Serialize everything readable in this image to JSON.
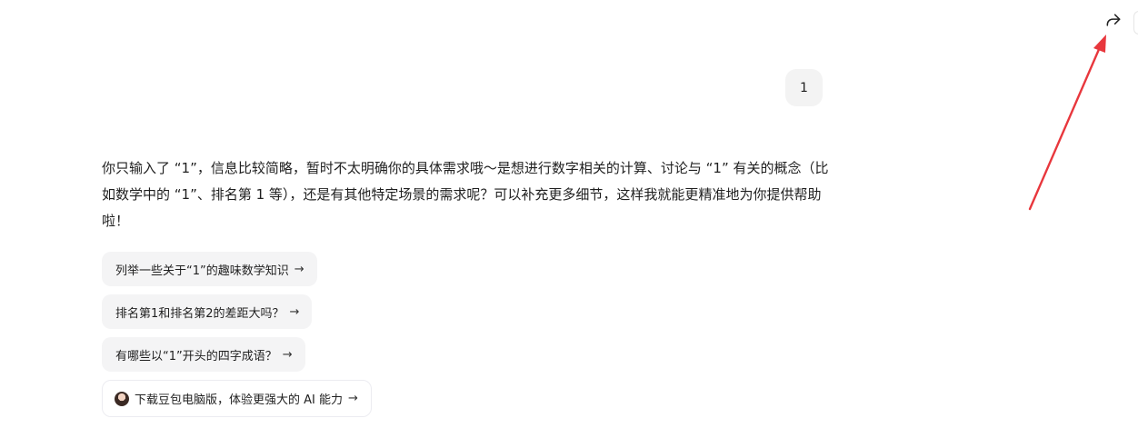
{
  "header": {
    "share_icon": "share-forward-icon"
  },
  "conversation": {
    "user_message": "1",
    "reply_text": "你只输入了 “1”，信息比较简略，暂时不太明确你的具体需求哦～是想进行数字相关的计算、讨论与 “1” 有关的概念（比如数学中的 “1”、排名第 1 等），还是有其他特定场景的需求呢？可以补充更多细节，这样我就能更精准地为你提供帮助啦！"
  },
  "suggestions": [
    {
      "label": "列举一些关于“1”的趣味数学知识",
      "arrow": "→"
    },
    {
      "label": "排名第1和排名第2的差距大吗？",
      "arrow": "→"
    },
    {
      "label": "有哪些以“1”开头的四字成语？",
      "arrow": "→"
    }
  ],
  "promo": {
    "label": "下载豆包电脑版，体验更强大的 AI 能力",
    "arrow": "→",
    "avatar_icon": "doubao-avatar-icon"
  },
  "annotation": {
    "color": "#e8373d"
  }
}
